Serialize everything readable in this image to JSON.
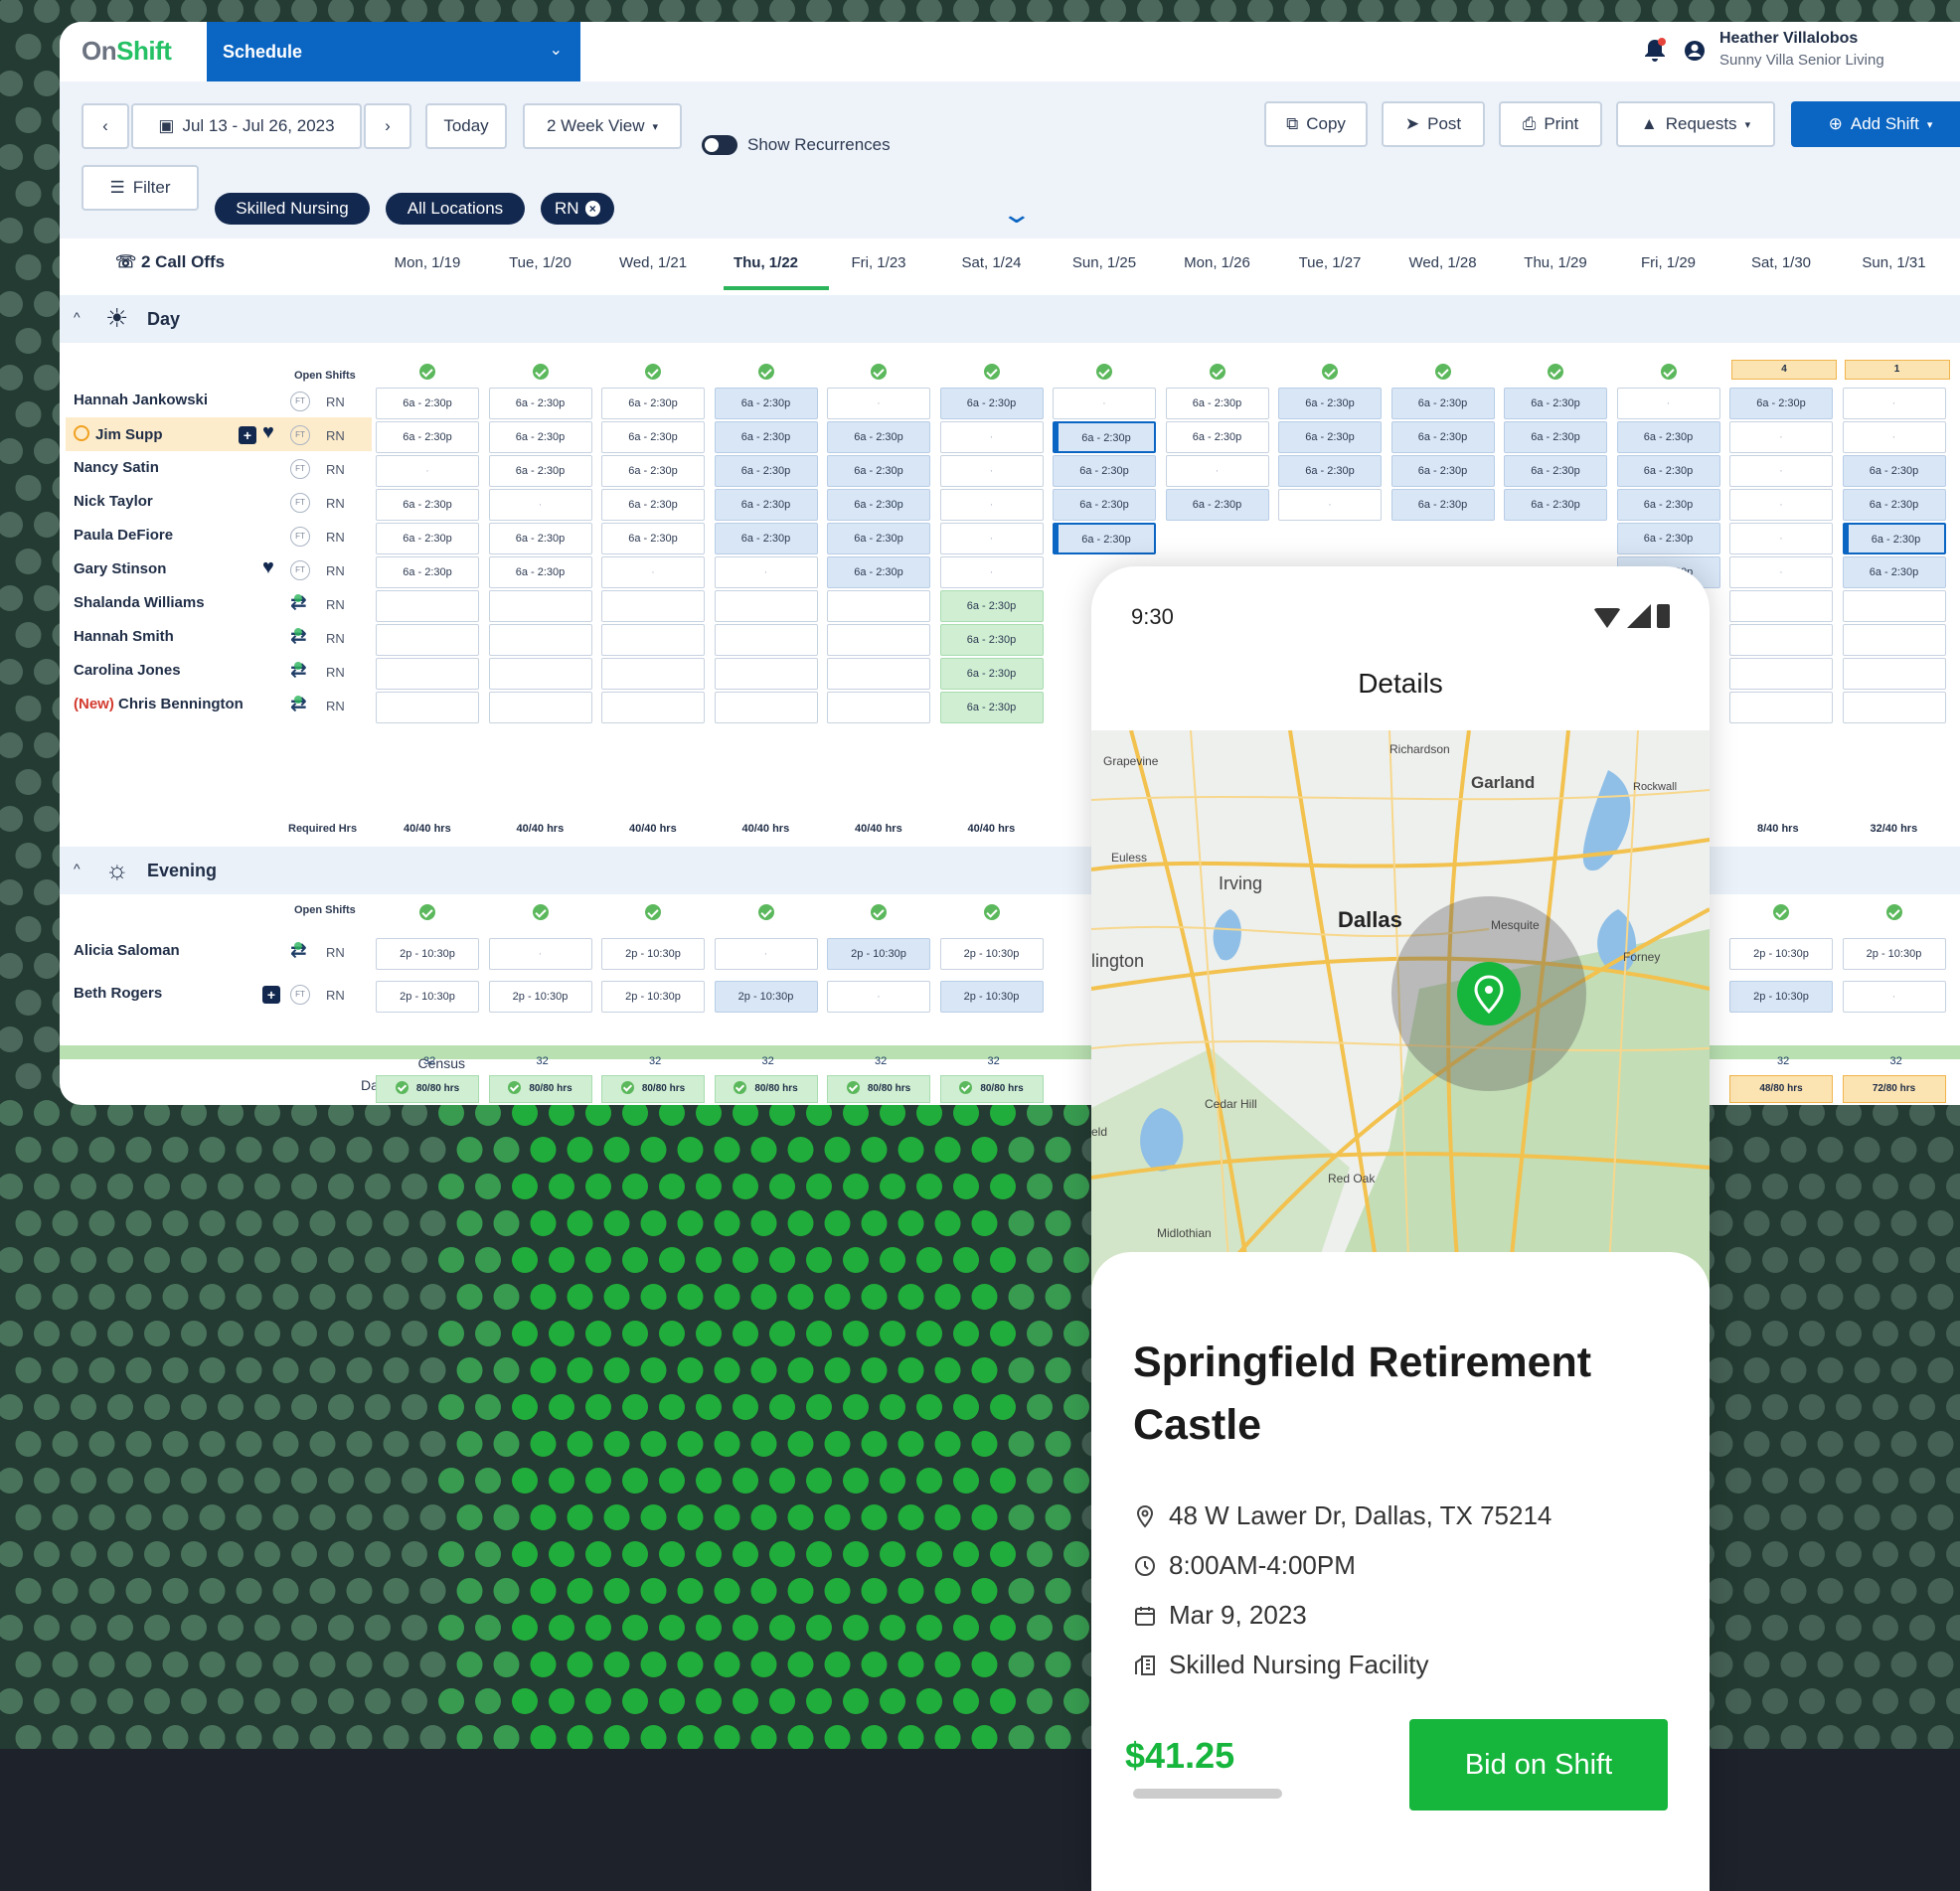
{
  "app": {
    "logo": "OnShift",
    "module": "Schedule",
    "user_name": "Heather Villalobos",
    "user_org": "Sunny Villa Senior Living"
  },
  "toolbar": {
    "date_range": "Jul 13 - Jul 26, 2023",
    "today_label": "Today",
    "view_label": "2 Week View",
    "show_recurrences_label": "Show Recurrences",
    "copy_label": "Copy",
    "post_label": "Post",
    "print_label": "Print",
    "requests_label": "Requests",
    "add_shift_label": "Add Shift",
    "filter_label": "Filter",
    "chips": [
      "Skilled Nursing",
      "All Locations",
      "RN"
    ]
  },
  "schedule": {
    "call_offs": "2 Call Offs",
    "days": [
      "Mon, 1/19",
      "Tue, 1/20",
      "Wed, 1/21",
      "Thu, 1/22",
      "Fri, 1/23",
      "Sat, 1/24",
      "Sun, 1/25",
      "Mon, 1/26",
      "Tue, 1/27",
      "Wed, 1/28",
      "Thu, 1/29",
      "Fri, 1/29",
      "Sat, 1/30",
      "Sun, 1/31"
    ],
    "selected_day_index": 3,
    "open_shifts_label": "Open Shifts",
    "required_hrs_label": "Required Hrs",
    "day_section": {
      "title": "Day",
      "open_badges": [
        "4",
        "1"
      ],
      "employees": [
        {
          "name": "Hannah Jankowski",
          "type": "FT",
          "role": "RN",
          "cells": [
            "s",
            "s",
            "s",
            "b",
            "e",
            "b",
            "e",
            "s",
            "b",
            "b",
            "b",
            "e",
            "b",
            "e"
          ]
        },
        {
          "name": "Jim Supp",
          "type": "FT",
          "role": "RN",
          "cells": [
            "s",
            "s",
            "s",
            "b",
            "b",
            "e",
            "x",
            "s",
            "b",
            "b",
            "b",
            "b",
            "e",
            "e"
          ]
        },
        {
          "name": "Nancy Satin",
          "type": "FT",
          "role": "RN",
          "cells": [
            "e",
            "s",
            "s",
            "b",
            "b",
            "e",
            "b",
            "e",
            "b",
            "b",
            "b",
            "b",
            "e",
            "b"
          ]
        },
        {
          "name": "Nick Taylor",
          "type": "FT",
          "role": "RN",
          "cells": [
            "s",
            "e",
            "s",
            "b",
            "b",
            "e",
            "b",
            "b",
            "e",
            "b",
            "b",
            "b",
            "e",
            "b"
          ]
        },
        {
          "name": "Paula DeFiore",
          "type": "FT",
          "role": "RN",
          "cells": [
            "s",
            "s",
            "s",
            "b",
            "b",
            "e",
            "x",
            "",
            "",
            "",
            "",
            "b",
            "e",
            "x"
          ]
        },
        {
          "name": "Gary Stinson",
          "type": "FT",
          "role": "RN",
          "cells": [
            "s",
            "s",
            "e",
            "e",
            "b",
            "e",
            "",
            "",
            "",
            "",
            "",
            "b",
            "e",
            "b"
          ]
        },
        {
          "name": "Shalanda Williams",
          "type": "",
          "role": "RN",
          "cells": [
            "n",
            "n",
            "n",
            "n",
            "n",
            "g",
            "",
            "",
            "",
            "",
            "",
            "",
            "n",
            "n"
          ]
        },
        {
          "name": "Hannah Smith",
          "type": "",
          "role": "RN",
          "cells": [
            "n",
            "n",
            "n",
            "n",
            "n",
            "g",
            "",
            "",
            "",
            "",
            "",
            "",
            "n",
            "n"
          ]
        },
        {
          "name": "Carolina Jones",
          "type": "",
          "role": "RN",
          "cells": [
            "n",
            "n",
            "n",
            "n",
            "n",
            "g",
            "",
            "",
            "",
            "",
            "",
            "",
            "n",
            "n"
          ]
        },
        {
          "name": "Chris Bennington",
          "prefix": "(New)",
          "type": "",
          "role": "RN",
          "cells": [
            "n",
            "n",
            "n",
            "n",
            "n",
            "g",
            "",
            "",
            "",
            "",
            "",
            "",
            "n",
            "n"
          ]
        }
      ],
      "shift_label": "6a - 2:30p",
      "required": [
        "40/40 hrs",
        "40/40 hrs",
        "40/40 hrs",
        "40/40 hrs",
        "40/40 hrs",
        "40/40 hrs",
        "",
        "",
        "",
        "",
        "",
        "",
        "8/40 hrs",
        "32/40 hrs"
      ]
    },
    "evening_section": {
      "title": "Evening",
      "shift_label": "2p - 10:30p",
      "employees": [
        {
          "name": "Alicia Saloman",
          "type": "",
          "role": "RN",
          "cells": [
            "s",
            "e",
            "s",
            "e",
            "b",
            "s",
            "",
            "",
            "",
            "",
            "",
            "",
            "s",
            "s"
          ]
        },
        {
          "name": "Beth Rogers",
          "type": "FT",
          "role": "RN",
          "cells": [
            "s",
            "s",
            "s",
            "b",
            "e",
            "b",
            "",
            "",
            "",
            "",
            "",
            "",
            "b",
            "e"
          ]
        }
      ]
    },
    "census_label": "Census",
    "budget_label": "Daily Budget Hrs",
    "census_values": [
      "32",
      "32",
      "32",
      "32",
      "32",
      "32",
      "",
      "",
      "",
      "",
      "",
      "",
      "32",
      "32"
    ],
    "budget_values": [
      "80/80 hrs",
      "80/80 hrs",
      "80/80 hrs",
      "80/80 hrs",
      "80/80 hrs",
      "80/80 hrs",
      "",
      "",
      "",
      "",
      "",
      "",
      "48/80 hrs",
      "72/80 hrs"
    ]
  },
  "phone": {
    "time": "9:30",
    "title": "Details",
    "map_labels": [
      "Grapevine",
      "Richardson",
      "Garland",
      "Rockwall",
      "Euless",
      "Irving",
      "Dallas",
      "Mesquite",
      "Forney",
      "lington",
      "Cedar Hill",
      "Red Oak",
      "Midlothian",
      "eld"
    ],
    "facility_name": "Springfield Retirement Castle",
    "address": "48 W Lawer Dr, Dallas, TX 75214",
    "hours": "8:00AM-4:00PM",
    "date": "Mar 9, 2023",
    "facility_type": "Skilled Nursing Facility",
    "price": "$41.25",
    "bid_label": "Bid on Shift"
  },
  "colors": {
    "brand_blue": "#0b65c2",
    "navy": "#12284f",
    "green": "#16b53c",
    "background": "#233b32"
  }
}
